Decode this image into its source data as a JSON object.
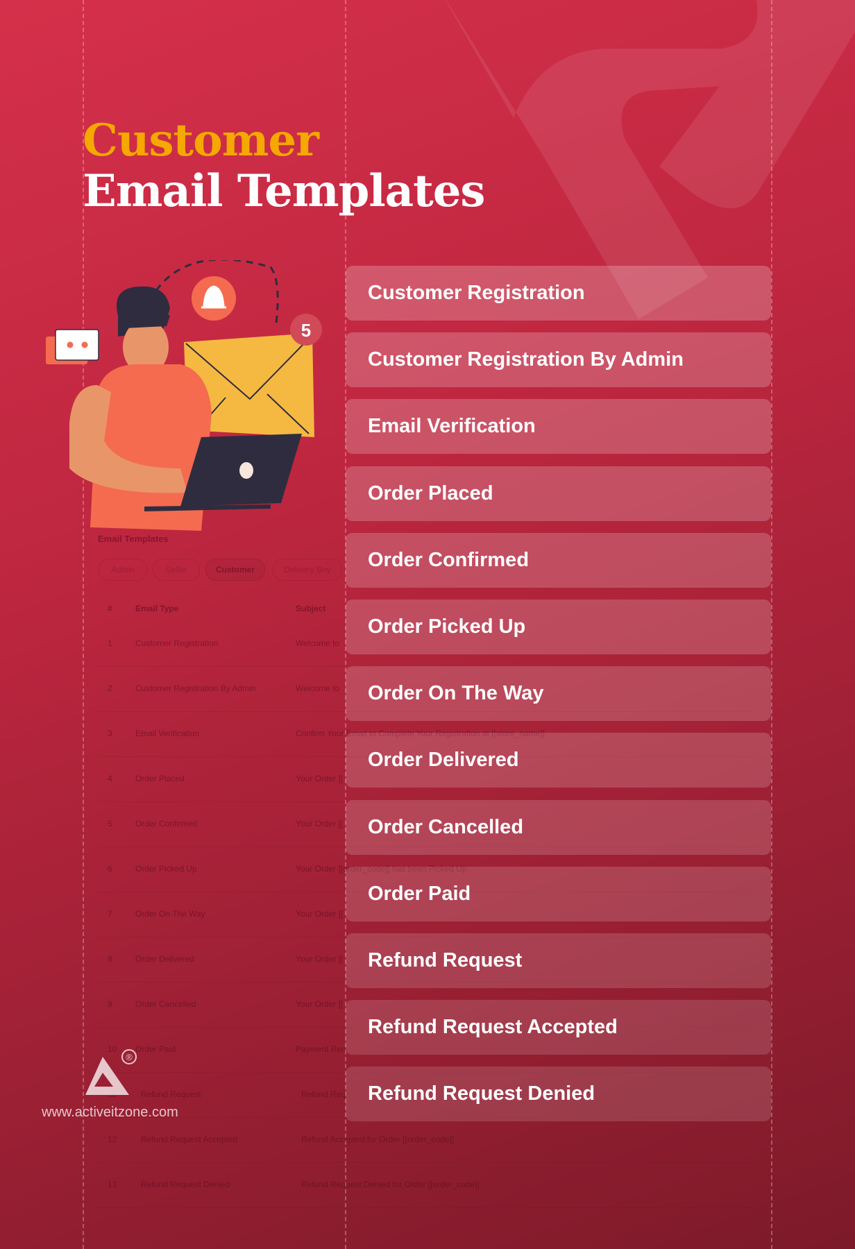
{
  "header": {
    "title_line1": "Customer",
    "title_line2": "Email Templates",
    "accent_color": "#f5a800"
  },
  "illustration": {
    "notification_count": "5",
    "icons": [
      "bell-icon",
      "envelope-icon",
      "chat-bubble-icon",
      "laptop-icon"
    ]
  },
  "templates": [
    "Customer Registration",
    "Customer Registration By Admin",
    "Email Verification",
    "Order Placed",
    "Order Confirmed",
    "Order Picked Up",
    "Order On The Way",
    "Order Delivered",
    "Order Cancelled",
    "Order Paid",
    "Refund Request",
    "Refund Request Accepted",
    "Refund Request Denied"
  ],
  "background_table": {
    "title": "Email Templates",
    "tabs": [
      "Admin",
      "Seller",
      "Customer",
      "Delivery Boy"
    ],
    "active_tab": "Customer",
    "headers": [
      "#",
      "Email Type",
      "Subject"
    ],
    "rows": [
      [
        "1",
        "Customer Registration",
        "Welcome to"
      ],
      [
        "2",
        "Customer Registration By Admin",
        "Welcome to"
      ],
      [
        "3",
        "Email Verification",
        "Confirm Your Email to Complete Your Registration at [[store_name]]"
      ],
      [
        "4",
        "Order Placed",
        "Your Order [["
      ],
      [
        "5",
        "Order Confirmed",
        "Your Order [["
      ],
      [
        "6",
        "Order Picked Up",
        "Your Order [[order_code]] has been Picked Up"
      ],
      [
        "7",
        "Order On The Way",
        "Your Order [["
      ],
      [
        "8",
        "Order Delivered",
        "Your Order [["
      ],
      [
        "9",
        "Order Cancelled",
        "Your Order [["
      ],
      [
        "10",
        "Order Paid",
        "Payment Rec"
      ],
      [
        "11",
        "Refund Request",
        "Refund Req"
      ],
      [
        "12",
        "Refund Request Accepted",
        "Refund Accepted for Order [[order_code]]"
      ],
      [
        "13",
        "Refund Request Denied",
        "Refund Request Denied for Order [[order_code]]"
      ]
    ]
  },
  "footer": {
    "website": "www.activeitzone.com",
    "registered_mark": "®"
  }
}
